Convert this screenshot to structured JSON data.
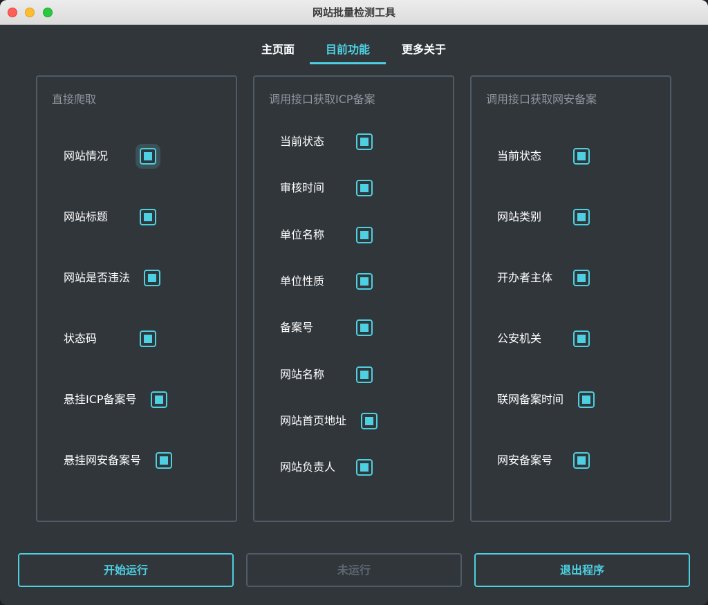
{
  "window": {
    "title": "网站批量检测工具"
  },
  "tabs": [
    {
      "label": "主页面",
      "active": false
    },
    {
      "label": "目前功能",
      "active": true
    },
    {
      "label": "更多关于",
      "active": false
    }
  ],
  "panels": [
    {
      "title": "直接爬取",
      "items": [
        {
          "label": "网站情况",
          "checked": true
        },
        {
          "label": "网站标题",
          "checked": true
        },
        {
          "label": "网站是否违法",
          "checked": true
        },
        {
          "label": "状态码",
          "checked": true
        },
        {
          "label": "悬挂ICP备案号",
          "checked": true
        },
        {
          "label": "悬挂网安备案号",
          "checked": true
        }
      ]
    },
    {
      "title": "调用接口获取ICP备案",
      "items": [
        {
          "label": "当前状态",
          "checked": true
        },
        {
          "label": "审核时间",
          "checked": true
        },
        {
          "label": "单位名称",
          "checked": true
        },
        {
          "label": "单位性质",
          "checked": true
        },
        {
          "label": "备案号",
          "checked": true
        },
        {
          "label": "网站名称",
          "checked": true
        },
        {
          "label": "网站首页地址",
          "checked": true
        },
        {
          "label": "网站负责人",
          "checked": true
        }
      ]
    },
    {
      "title": "调用接口获取网安备案",
      "items": [
        {
          "label": "当前状态",
          "checked": true
        },
        {
          "label": "网站类别",
          "checked": true
        },
        {
          "label": "开办者主体",
          "checked": true
        },
        {
          "label": "公安机关",
          "checked": true
        },
        {
          "label": "联网备案时间",
          "checked": true
        },
        {
          "label": "网安备案号",
          "checked": true
        }
      ]
    }
  ],
  "buttons": {
    "start": "开始运行",
    "not_running": "未运行",
    "exit": "退出程序"
  },
  "colors": {
    "accent": "#4dd0e1",
    "background": "#31363b",
    "border": "#4f5b66"
  }
}
